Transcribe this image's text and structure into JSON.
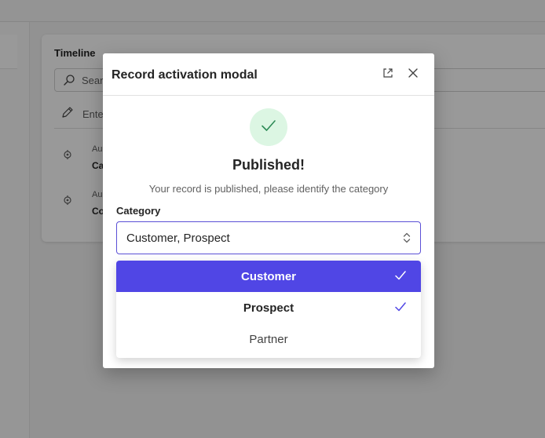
{
  "background": {
    "timeline": {
      "title": "Timeline",
      "search_text": "Sear",
      "note_text": "Ente",
      "items": [
        {
          "line1": "Au",
          "line2": "Ca"
        },
        {
          "line1": "Au",
          "line2": "Co"
        }
      ]
    }
  },
  "modal": {
    "title": "Record activation modal",
    "status_title": "Published!",
    "status_subtitle": "Your record is published, please identify the category",
    "category_label": "Category",
    "category_value": "Customer, Prospect",
    "options": [
      {
        "label": "Customer",
        "selected": true,
        "highlighted": true
      },
      {
        "label": "Prospect",
        "selected": true,
        "highlighted": false
      },
      {
        "label": "Partner",
        "selected": false,
        "highlighted": false
      }
    ]
  },
  "colors": {
    "accent": "#5046e5",
    "success_bg": "#dcf6e3",
    "success_icon": "#2e8b57"
  },
  "icons": {
    "search": "search-icon",
    "pencil": "pencil-icon",
    "activity": "activity-icon",
    "expand": "expand-icon",
    "close": "close-icon",
    "check": "check-icon",
    "chevron": "chevron-up-down-icon"
  }
}
